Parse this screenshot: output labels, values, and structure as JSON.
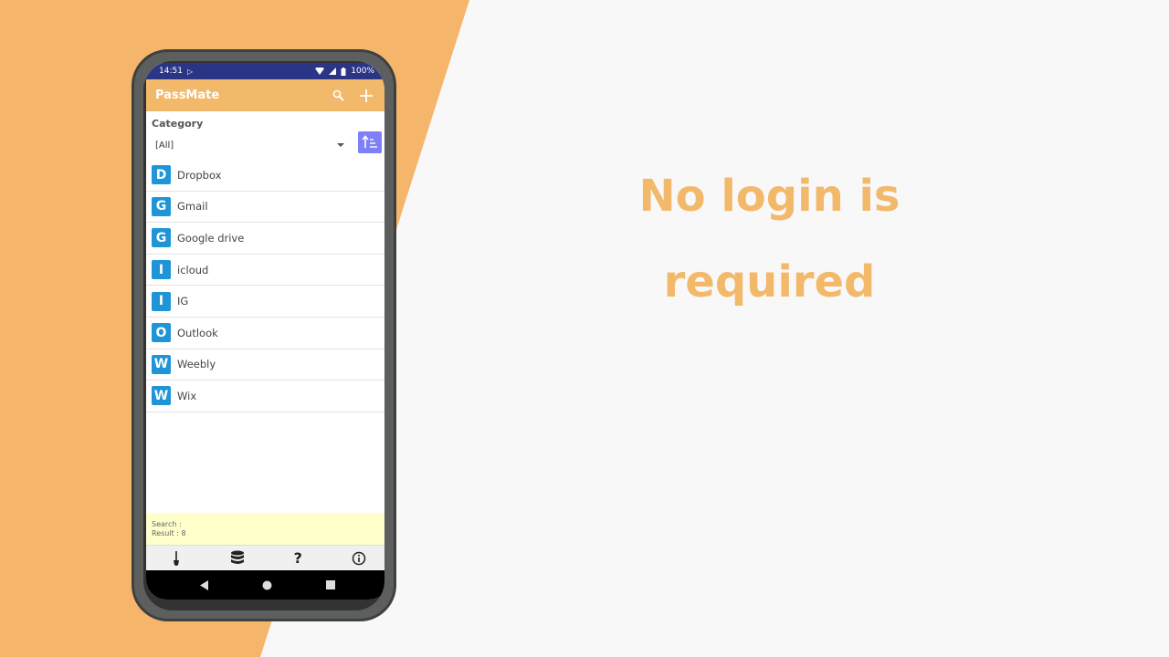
{
  "headline": {
    "line1": "No login is",
    "line2": "required"
  },
  "colors": {
    "accent_orange": "#f3b96b",
    "status_bar": "#2b3585",
    "letter_badge": "#1f95d8",
    "sort_button": "#7f7ff7",
    "search_info_bg": "#ffffcc"
  },
  "status_bar": {
    "time": "14:51",
    "battery": "100%",
    "icons": [
      "play-store-icon",
      "wifi-icon",
      "signal-icon",
      "battery-icon"
    ]
  },
  "app_bar": {
    "title": "PassMate",
    "icons": [
      "search-icon",
      "add-icon"
    ]
  },
  "category": {
    "label": "Category",
    "selected": "[All]"
  },
  "entries": [
    {
      "letter": "D",
      "name": "Dropbox"
    },
    {
      "letter": "G",
      "name": "Gmail"
    },
    {
      "letter": "G",
      "name": "Google drive"
    },
    {
      "letter": "I",
      "name": "icloud"
    },
    {
      "letter": "I",
      "name": "IG"
    },
    {
      "letter": "O",
      "name": "Outlook"
    },
    {
      "letter": "W",
      "name": "Weebly"
    },
    {
      "letter": "W",
      "name": "Wix"
    }
  ],
  "search_info": {
    "search_line": "Search :",
    "result_line": "Result : 8"
  },
  "bottom_nav": {
    "items": [
      "brush-icon",
      "database-icon",
      "help-icon",
      "info-icon"
    ],
    "help_glyph": "?"
  },
  "system_nav": [
    "back-icon",
    "home-icon",
    "recents-icon"
  ]
}
